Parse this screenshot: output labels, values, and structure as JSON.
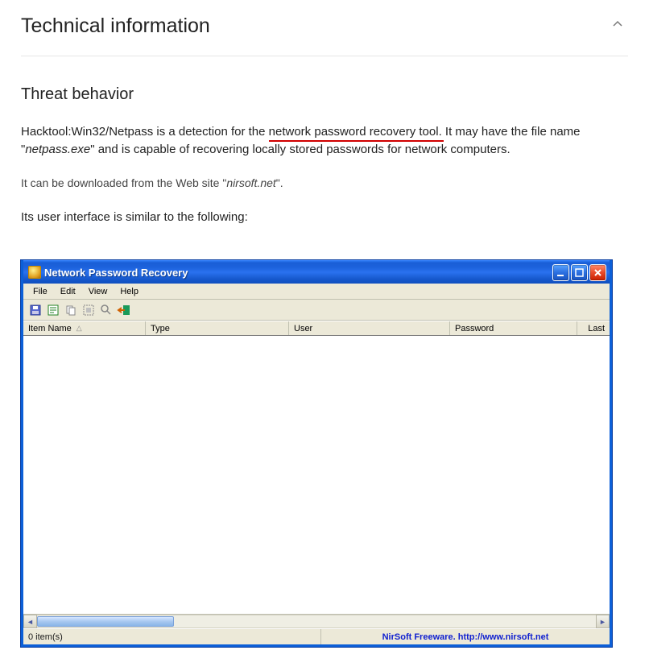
{
  "section": {
    "title": "Technical information"
  },
  "threat": {
    "heading": "Threat behavior",
    "p1_a": "Hacktool:Win32/Netpass is a detection for the ",
    "p1_highlight": "network password recovery tool.",
    "p1_b": " It may have the file name \"",
    "p1_filename": "netpass.exe",
    "p1_c": "\" and is capable of recovering locally stored passwords for network computers.",
    "p2_a": "It can be downloaded from the Web site \"",
    "p2_site": "nirsoft.net",
    "p2_b": "\".",
    "p3": "Its user interface is similar to the following:"
  },
  "xp": {
    "title": "Network Password Recovery",
    "menu": {
      "file": "File",
      "edit": "Edit",
      "view": "View",
      "help": "Help"
    },
    "columns": {
      "item": "Item Name",
      "type": "Type",
      "user": "User",
      "password": "Password",
      "last": "Last"
    },
    "status_count": "0 item(s)",
    "status_brand": "NirSoft Freeware.  http://www.nirsoft.net"
  }
}
